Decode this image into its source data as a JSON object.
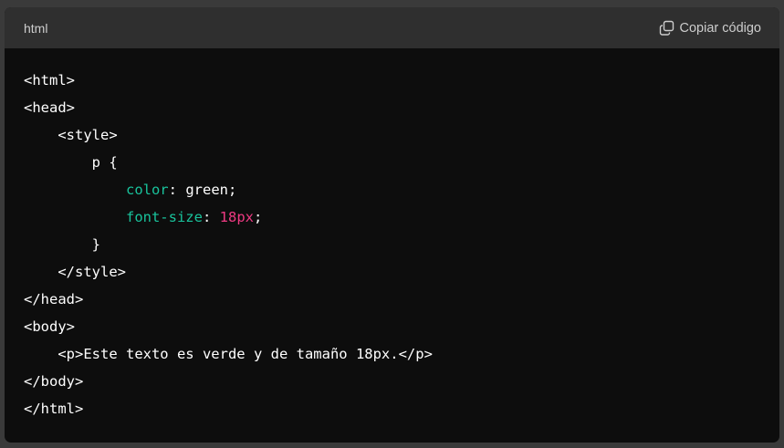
{
  "header": {
    "language": "html",
    "copy_label": "Copiar código",
    "copy_icon": "copy-icon"
  },
  "colors": {
    "background": "#0d0d0d",
    "header_bg": "#2f2f2f",
    "property": "#19c39c",
    "number": "#ee3a82",
    "text": "#ffffff"
  },
  "code": {
    "line1": "<html>",
    "line2": "<head>",
    "line3": "    <style>",
    "line4": "        p {",
    "line5_indent": "            ",
    "line5_prop": "color",
    "line5_rest": ": green;",
    "line6_indent": "            ",
    "line6_prop": "font-size",
    "line6_colon": ": ",
    "line6_num": "18px",
    "line6_semi": ";",
    "line7": "        }",
    "line8": "    </style>",
    "line9": "</head>",
    "line10": "<body>",
    "line11": "    <p>Este texto es verde y de tamaño 18px.</p>",
    "line12": "</body>",
    "line13": "</html>"
  }
}
